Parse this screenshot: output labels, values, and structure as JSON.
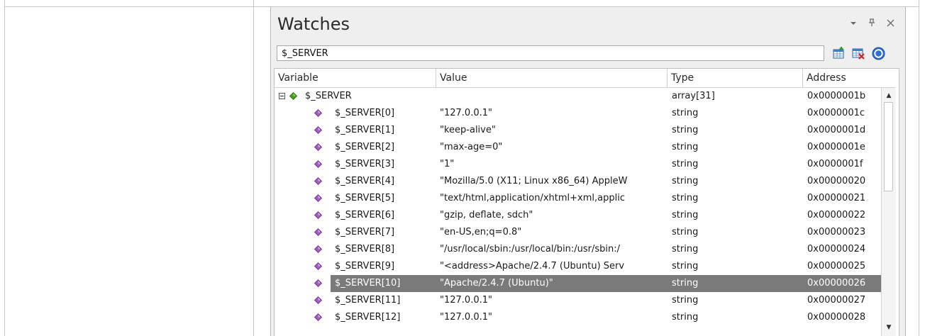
{
  "panel": {
    "title": "Watches",
    "controls": {
      "dropdown_icon": "chevron-down-icon",
      "pin_icon": "pin-icon",
      "close_icon": "close-icon"
    }
  },
  "search": {
    "value": "$_SERVER"
  },
  "toolbar": {
    "buttons": [
      {
        "name": "add-watch-button",
        "icon": "add-table-icon"
      },
      {
        "name": "remove-watch-button",
        "icon": "delete-table-icon"
      },
      {
        "name": "help-button",
        "icon": "help-icon"
      }
    ]
  },
  "columns": [
    "Variable",
    "Value",
    "Type",
    "Address"
  ],
  "root": {
    "name": "$_SERVER",
    "value": "",
    "type": "array[31]",
    "address": "0x0000001b"
  },
  "rows": [
    {
      "name": "$_SERVER[0]",
      "value": "\"127.0.0.1\"",
      "type": "string",
      "address": "0x0000001c"
    },
    {
      "name": "$_SERVER[1]",
      "value": "\"keep-alive\"",
      "type": "string",
      "address": "0x0000001d"
    },
    {
      "name": "$_SERVER[2]",
      "value": "\"max-age=0\"",
      "type": "string",
      "address": "0x0000001e"
    },
    {
      "name": "$_SERVER[3]",
      "value": "\"1\"",
      "type": "string",
      "address": "0x0000001f"
    },
    {
      "name": "$_SERVER[4]",
      "value": "\"Mozilla/5.0 (X11; Linux x86_64) AppleW",
      "type": "string",
      "address": "0x00000020"
    },
    {
      "name": "$_SERVER[5]",
      "value": "\"text/html,application/xhtml+xml,applic",
      "type": "string",
      "address": "0x00000021"
    },
    {
      "name": "$_SERVER[6]",
      "value": "\"gzip, deflate, sdch\"",
      "type": "string",
      "address": "0x00000022"
    },
    {
      "name": "$_SERVER[7]",
      "value": "\"en-US,en;q=0.8\"",
      "type": "string",
      "address": "0x00000023"
    },
    {
      "name": "$_SERVER[8]",
      "value": "\"/usr/local/sbin:/usr/local/bin:/usr/sbin:/",
      "type": "string",
      "address": "0x00000024"
    },
    {
      "name": "$_SERVER[9]",
      "value": "\"<address>Apache/2.4.7 (Ubuntu) Serv",
      "type": "string",
      "address": "0x00000025"
    },
    {
      "name": "$_SERVER[10]",
      "value": "\"Apache/2.4.7 (Ubuntu)\"",
      "type": "string",
      "address": "0x00000026",
      "selected": true
    },
    {
      "name": "$_SERVER[11]",
      "value": "\"127.0.0.1\"",
      "type": "string",
      "address": "0x00000027"
    },
    {
      "name": "$_SERVER[12]",
      "value": "\"127.0.0.1\"",
      "type": "string",
      "address": "0x00000028"
    }
  ],
  "colors": {
    "selection": "#7a7a7a",
    "root_gem": "#4e9a1e",
    "item_gem": "#a05bbf",
    "panel_bg": "#efefef"
  }
}
